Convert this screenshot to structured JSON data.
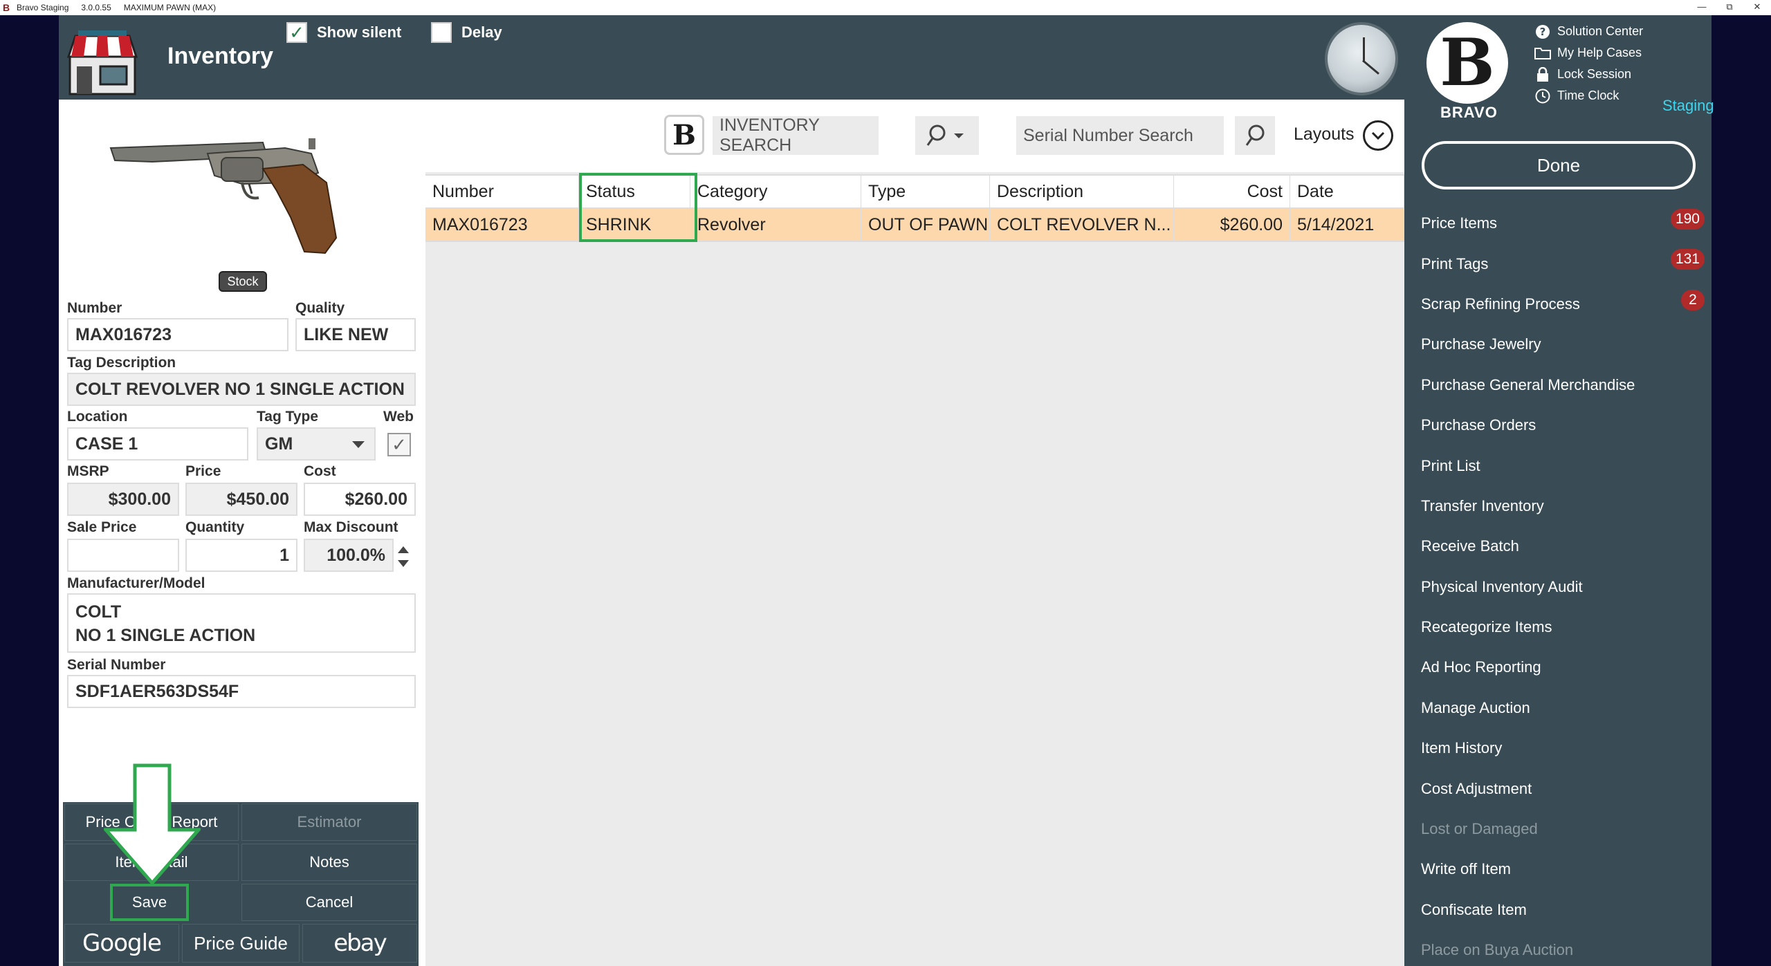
{
  "titlebar": {
    "app": "Bravo Staging",
    "version": "3.0.0.55",
    "store": "MAXIMUM PAWN (MAX)"
  },
  "header": {
    "title": "Inventory",
    "show_silent_label": "Show silent",
    "show_silent_checked": true,
    "delay_label": "Delay",
    "delay_checked": false
  },
  "brand": {
    "name": "BRAVO",
    "staging_label": "Staging"
  },
  "help_links": [
    {
      "label": "Solution Center",
      "icon": "question-circle-icon"
    },
    {
      "label": "My Help Cases",
      "icon": "folder-icon"
    },
    {
      "label": "Lock Session",
      "icon": "lock-icon"
    },
    {
      "label": "Time Clock",
      "icon": "clock-icon"
    }
  ],
  "done_label": "Done",
  "menu": [
    {
      "label": "Price Items",
      "badge": "190",
      "disabled": false
    },
    {
      "label": "Print Tags",
      "badge": "131",
      "disabled": false
    },
    {
      "label": "Scrap Refining Process",
      "badge": "2",
      "disabled": false
    },
    {
      "label": "Purchase Jewelry",
      "badge": "",
      "disabled": false
    },
    {
      "label": "Purchase General Merchandise",
      "badge": "",
      "disabled": false
    },
    {
      "label": "Purchase Orders",
      "badge": "",
      "disabled": false
    },
    {
      "label": "Print List",
      "badge": "",
      "disabled": false
    },
    {
      "label": "Transfer Inventory",
      "badge": "",
      "disabled": false
    },
    {
      "label": "Receive Batch",
      "badge": "",
      "disabled": false
    },
    {
      "label": "Physical Inventory Audit",
      "badge": "",
      "disabled": false
    },
    {
      "label": "Recategorize Items",
      "badge": "",
      "disabled": false
    },
    {
      "label": "Ad Hoc Reporting",
      "badge": "",
      "disabled": false
    },
    {
      "label": "Manage Auction",
      "badge": "",
      "disabled": false
    },
    {
      "label": "Item History",
      "badge": "",
      "disabled": false
    },
    {
      "label": "Cost Adjustment",
      "badge": "",
      "disabled": false
    },
    {
      "label": "Lost or Damaged",
      "badge": "",
      "disabled": true
    },
    {
      "label": "Write off Item",
      "badge": "",
      "disabled": false
    },
    {
      "label": "Confiscate Item",
      "badge": "",
      "disabled": false
    },
    {
      "label": "Place on Buya Auction",
      "badge": "",
      "disabled": true
    }
  ],
  "item": {
    "stock_tag": "Stock",
    "number_label": "Number",
    "number": "MAX016723",
    "quality_label": "Quality",
    "quality": "LIKE NEW",
    "tag_description_label": "Tag Description",
    "tag_description": "COLT REVOLVER NO 1 SINGLE ACTION",
    "location_label": "Location",
    "location": "CASE 1",
    "tag_type_label": "Tag Type",
    "tag_type": "GM",
    "web_label": "Web",
    "web_checked": true,
    "msrp_label": "MSRP",
    "msrp": "$300.00",
    "price_label": "Price",
    "price": "$450.00",
    "cost_label": "Cost",
    "cost": "$260.00",
    "sale_price_label": "Sale Price",
    "sale_price": "",
    "quantity_label": "Quantity",
    "quantity": "1",
    "max_discount_label": "Max Discount",
    "max_discount": "100.0%",
    "manufacturer_label": "Manufacturer/Model",
    "manufacturer": "COLT",
    "model": "NO 1 SINGLE ACTION",
    "serial_label": "Serial Number",
    "serial": "SDF1AER563DS54F"
  },
  "actions": {
    "price_check_report": "Price Check Report",
    "estimator": "Estimator",
    "item_detail": "Item Detail",
    "notes": "Notes",
    "save": "Save",
    "cancel": "Cancel",
    "google": "Google",
    "price_guide": "Price Guide",
    "ebay": "ebay"
  },
  "search": {
    "inventory_placeholder": "INVENTORY SEARCH",
    "serial_placeholder": "Serial Number Search",
    "layouts_label": "Layouts"
  },
  "table": {
    "columns": [
      "Number",
      "Status",
      "Category",
      "Type",
      "Description",
      "Cost",
      "Date"
    ],
    "rows": [
      [
        "MAX016723",
        "SHRINK",
        "Revolver",
        "OUT OF PAWN",
        "COLT REVOLVER N...",
        "$260.00",
        "5/14/2021"
      ]
    ]
  },
  "colors": {
    "panel": "#394c55",
    "highlight_row": "#fed8ad",
    "annotation_green": "#2fa84f",
    "badge_red": "#b02a2a",
    "staging_cyan": "#3ad7f0"
  }
}
